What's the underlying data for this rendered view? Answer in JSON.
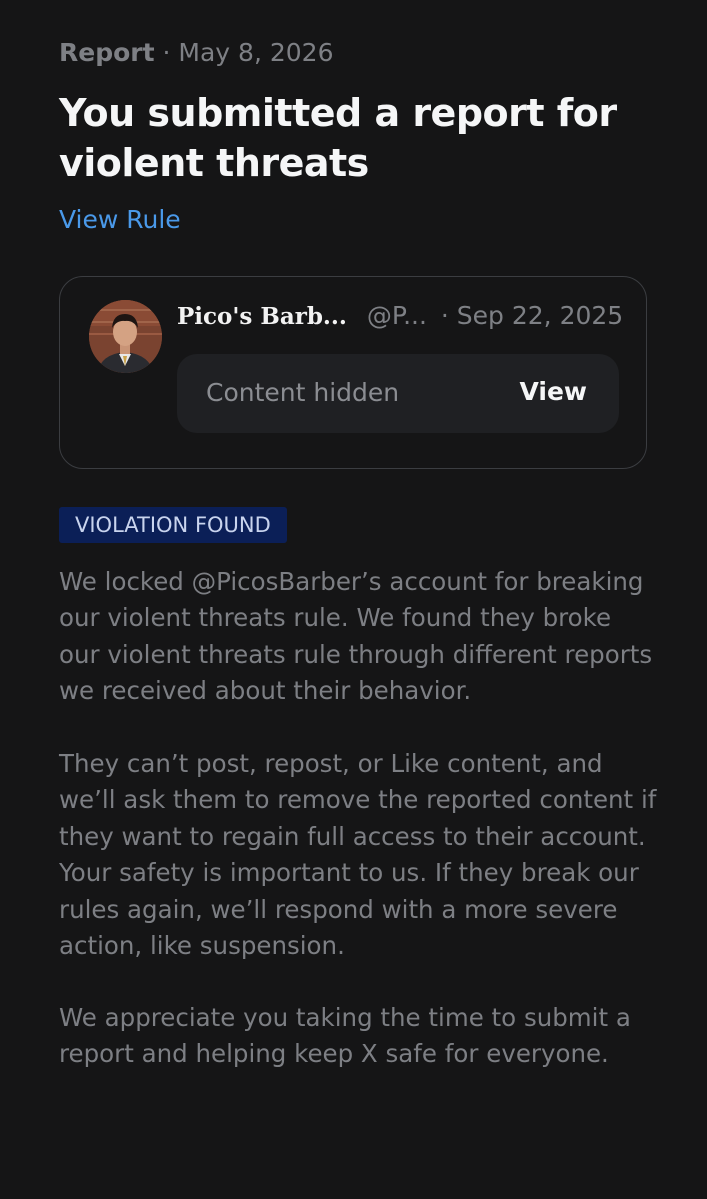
{
  "header": {
    "label": "Report",
    "separator": "·",
    "date": "May 8, 2026",
    "title": "You submitted a report for violent threats",
    "view_rule": "View Rule"
  },
  "post": {
    "name": "Pico's Barb...",
    "handle": "@P...",
    "separator": "·",
    "date": "Sep 22, 2025",
    "hidden_text": "Content hidden",
    "view_label": "View"
  },
  "status": {
    "badge": "VIOLATION FOUND",
    "badge_color": "#0b1f57"
  },
  "body": {
    "paragraph1": "We locked @PicosBarber’s account for breaking our violent threats rule. We found they broke our violent threats rule through different reports we received about their behavior.",
    "paragraph2": "They can’t post, repost, or Like content, and we’ll ask them to remove the reported content if they want to regain full access to their account. Your safety is important to us. If they break our rules again, we’ll respond with a more severe action, like suspension.",
    "paragraph3": "We appreciate you taking the time to submit a report and helping keep X safe for everyone."
  },
  "colors": {
    "background": "#151516",
    "link": "#4a99e9",
    "muted_text": "#7d7f84"
  }
}
